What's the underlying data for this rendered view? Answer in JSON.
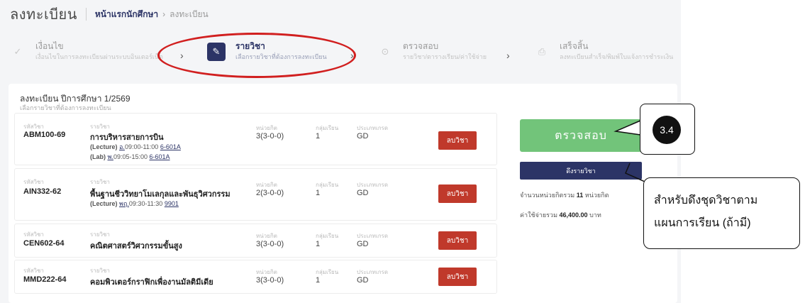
{
  "header": {
    "title": "ลงทะเบียน",
    "breadcrumb_home": "หน้าแรกนักศึกษา",
    "breadcrumb_separator": "›",
    "breadcrumb_current": "ลงทะเบียน"
  },
  "steps": [
    {
      "title": "เงื่อนไข",
      "subtitle": "เงื่อนไขในการลงทะเบียนผ่านระบบอินเตอร์เน็ต",
      "icon": "check-icon",
      "state": "done"
    },
    {
      "title": "รายวิชา",
      "subtitle": "เลือกรายวิชาที่ต้องการลงทะเบียน",
      "icon": "pencil-icon",
      "state": "active"
    },
    {
      "title": "ตรวจสอบ",
      "subtitle": "รายวิชา/ตารางเรียน/ค่าใช้จ่าย",
      "icon": "check-circle-icon",
      "state": "pending"
    },
    {
      "title": "เสร็จสิ้น",
      "subtitle": "ลงทะเบียนสำเร็จ/พิมพ์ใบแจ้งการชำระเงิน",
      "icon": "printer-icon",
      "state": "pending"
    }
  ],
  "step_chevron": "›",
  "panel": {
    "title": "ลงทะเบียน ปีการศึกษา 1/2569",
    "subtitle": "เลือกรายวิชาที่ต้องการลงทะเบียน"
  },
  "column_labels": {
    "code": "รหัสวิชา",
    "name": "รายวิชา",
    "credits": "หน่วยกิต",
    "section": "กลุ่มเรียน",
    "grade_type": "ประเภทเกรด"
  },
  "courses": [
    {
      "code": "ABM100-69",
      "name": "การบริหารสายการบิน",
      "schedule": [
        {
          "label": "(Lecture)",
          "day": "อ.",
          "time": "09:00-11:00",
          "room": "6-601A"
        },
        {
          "label": "(Lab)",
          "day": "พ.",
          "time": "09:05-15:00",
          "room": "6-601A"
        }
      ],
      "credits": "3(3-0-0)",
      "section": "1",
      "grade_type": "GD"
    },
    {
      "code": "AIN332-62",
      "name": "พื้นฐานชีววิทยาโมเลกุลและพันธุวิศวกรรม",
      "schedule": [
        {
          "label": "(Lecture)",
          "day": "พฤ.",
          "time": "09:30-11:30",
          "room": "9901"
        }
      ],
      "credits": "2(3-0-0)",
      "section": "1",
      "grade_type": "GD"
    },
    {
      "code": "CEN602-64",
      "name": "คณิตศาสตร์วิศวกรรมขั้นสูง",
      "schedule": [],
      "credits": "3(3-0-0)",
      "section": "1",
      "grade_type": "GD"
    },
    {
      "code": "MMD222-64",
      "name": "คอมพิวเตอร์กราฟิกเพื่องานมัลติมีเดีย",
      "schedule": [],
      "credits": "3(3-0-0)",
      "section": "1",
      "grade_type": "GD"
    }
  ],
  "drop_button_label": "ลบวิชา",
  "summary": {
    "check_button": "ตรวจสอบ",
    "pull_button": "ดึงรายวิชา",
    "total_credits_prefix": "จำนวนหน่วยกิตรวม",
    "total_credits": "11",
    "total_credits_unit": "หน่วยกิต",
    "total_cost_prefix": "ค่าใช้จ่ายรวม",
    "total_cost": "46,400.00",
    "total_cost_unit": "บาท"
  },
  "annotations": {
    "step_number": "3.4",
    "note_line1": "สำหรับดึงชุดวิชาตาม",
    "note_line2": "แผนการเรียน (ถ้ามี)"
  },
  "colors": {
    "navy": "#2c3466",
    "green": "#72c47a",
    "red": "#c0392b",
    "highlight": "#d11f1f"
  }
}
